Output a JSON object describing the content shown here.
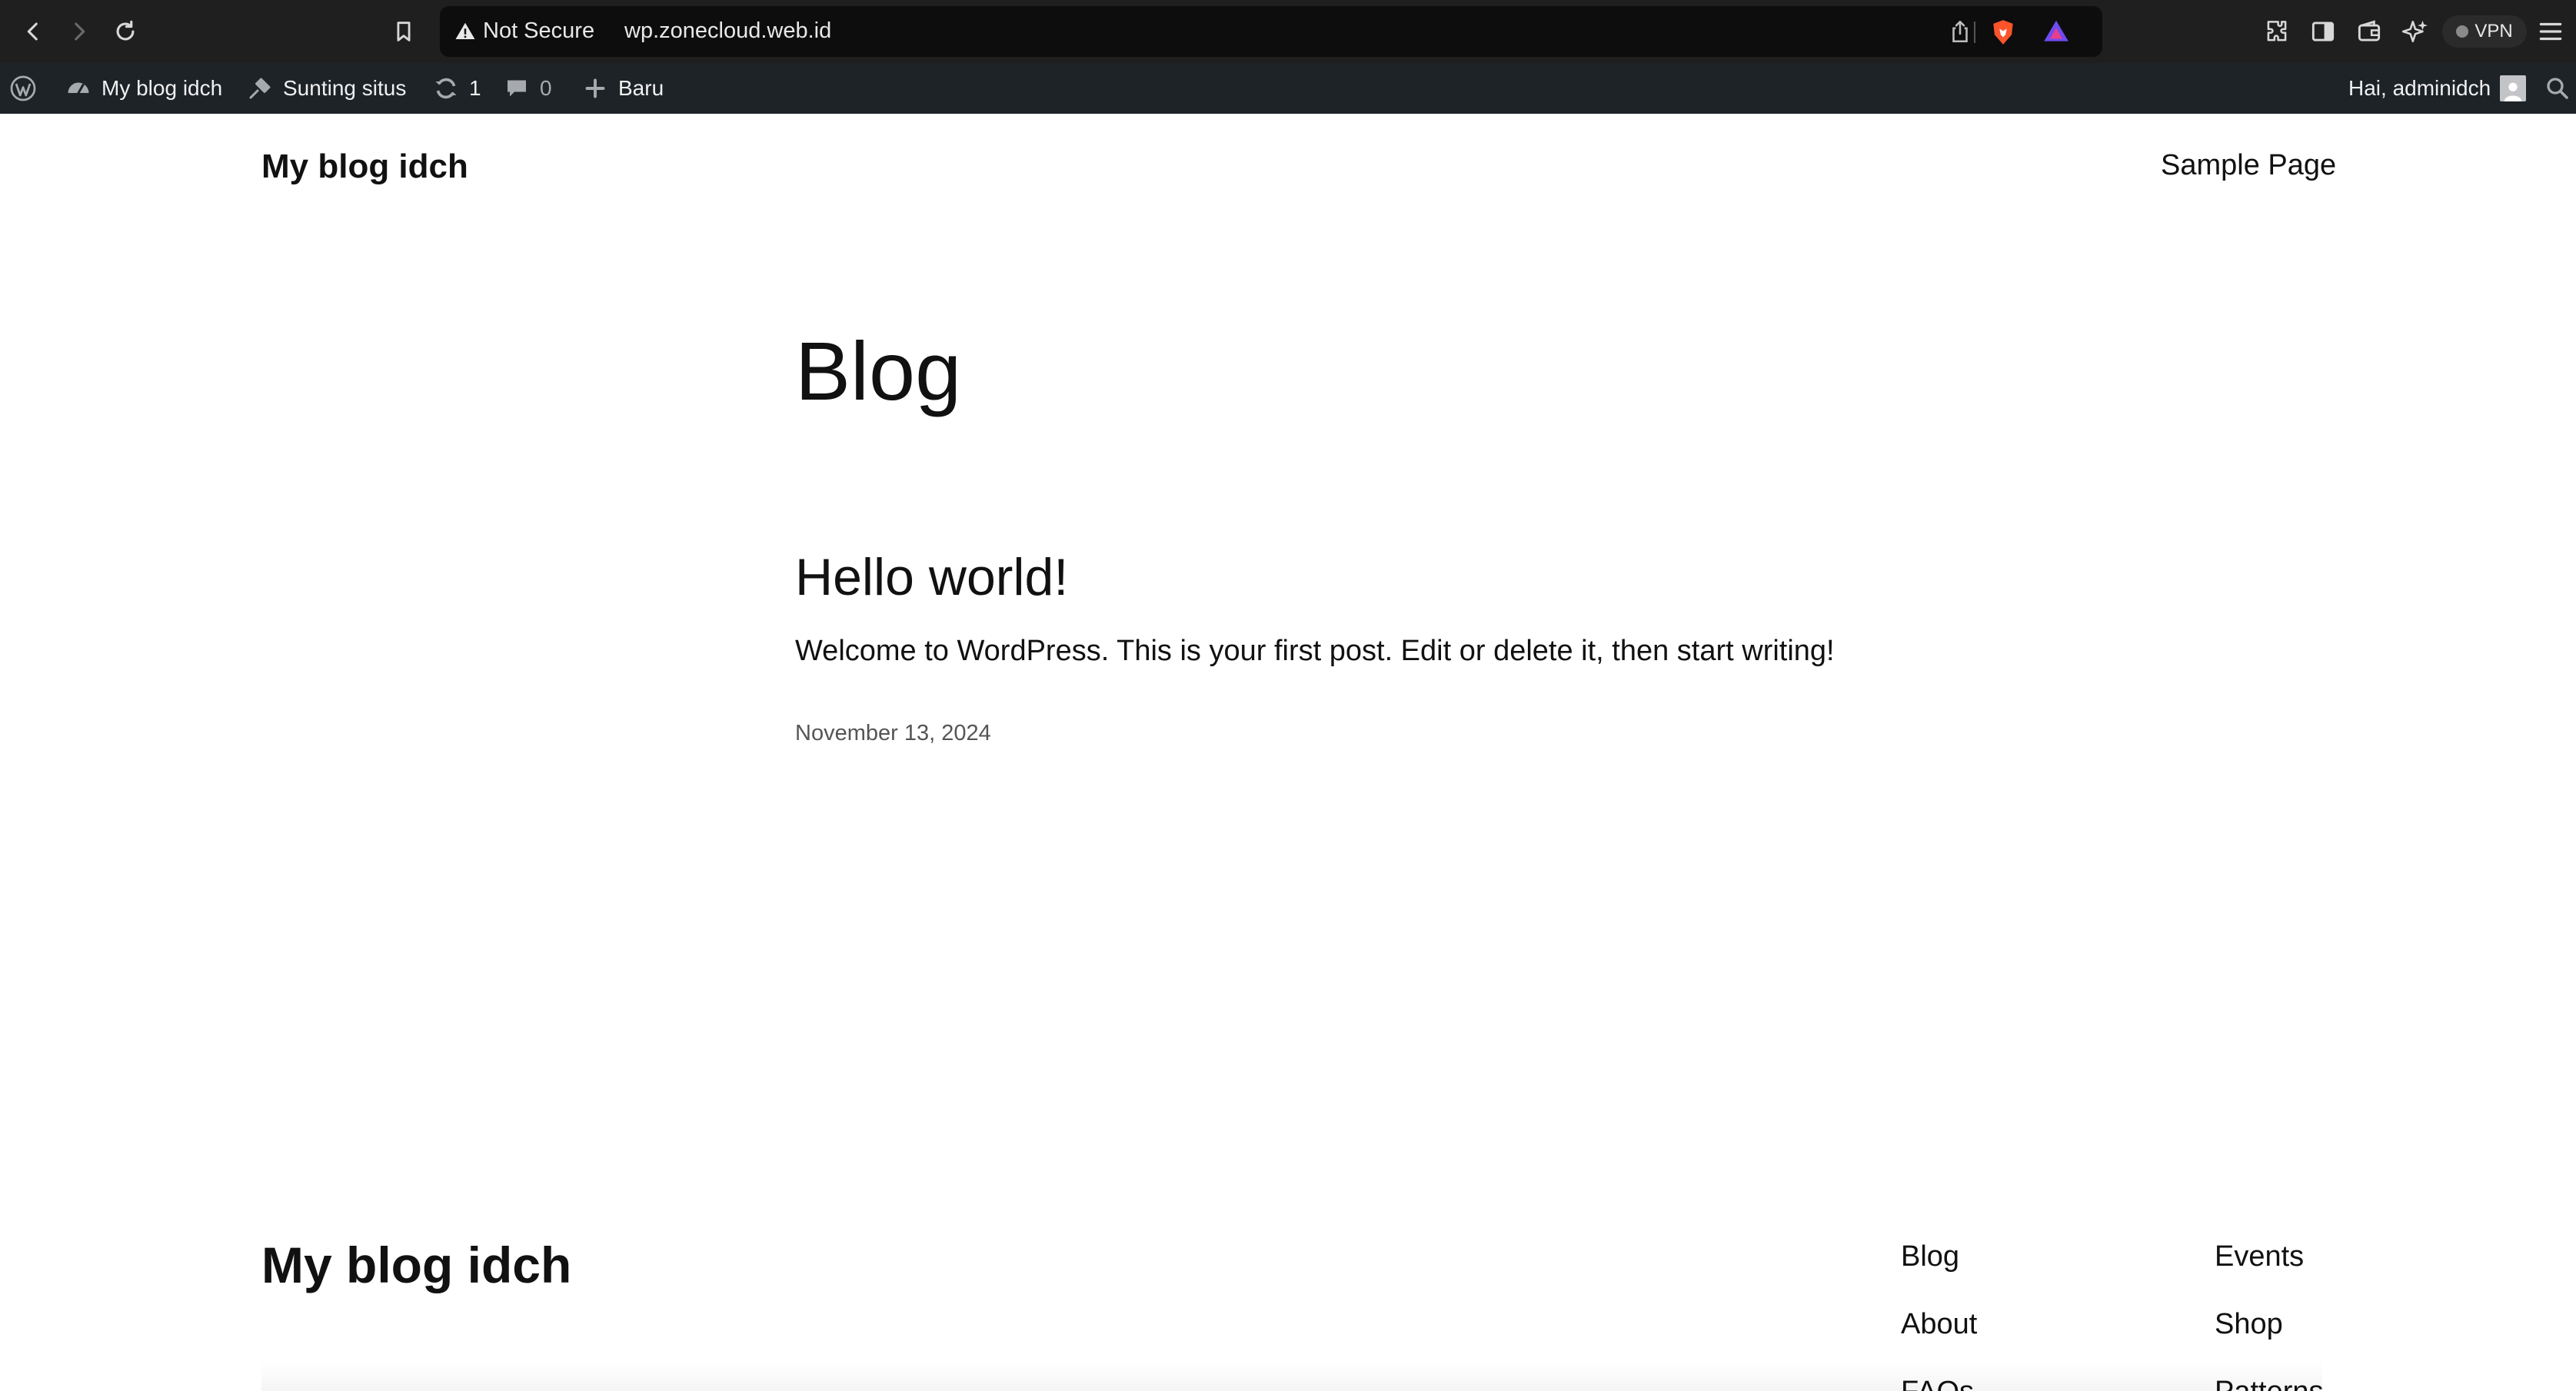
{
  "browser": {
    "url_security": "Not Secure",
    "url": "wp.zonecloud.web.id",
    "vpn_label": "VPN"
  },
  "admin_bar": {
    "site_name": "My blog idch",
    "customize": "Sunting situs",
    "updates_count": "1",
    "comments_count": "0",
    "new_label": "Baru",
    "greeting": "Hai, adminidch"
  },
  "header": {
    "site_title": "My blog idch",
    "nav": [
      "Sample Page"
    ]
  },
  "main": {
    "page_heading": "Blog",
    "posts": [
      {
        "title": "Hello world!",
        "excerpt": "Welcome to WordPress. This is your first post. Edit or delete it, then start writing!",
        "date": "November 13, 2024"
      }
    ]
  },
  "footer": {
    "site_title": "My blog idch",
    "col1": [
      "Blog",
      "About",
      "FAQs"
    ],
    "col2": [
      "Events",
      "Shop",
      "Patterns"
    ]
  }
}
